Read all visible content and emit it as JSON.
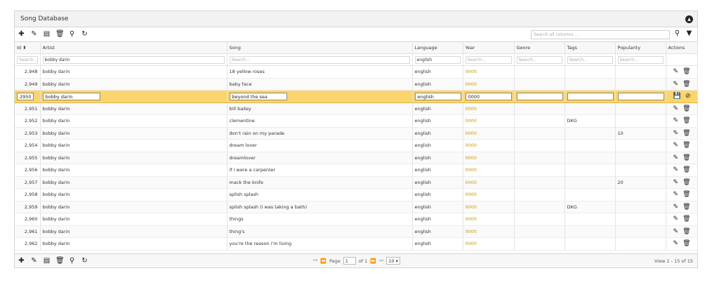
{
  "app": {
    "title": "Song Database"
  },
  "toolbar": {
    "search_placeholder": "Search all columns ..."
  },
  "columns": {
    "id": "Id",
    "artist": "Artist",
    "song": "Song",
    "language": "Language",
    "year": "Year",
    "genre": "Genre",
    "tags": "Tags",
    "popularity": "Popularity",
    "actions": "Actions"
  },
  "filters": {
    "id": "Search...",
    "artist": "bobby darin",
    "song": "Search...",
    "language": "english",
    "year": "Search...",
    "genre": "Search...",
    "tags": "Search...",
    "popularity": "Search..."
  },
  "rows": [
    {
      "id": "2,948",
      "artist": "bobby darin",
      "song": "18 yellow roses",
      "language": "english",
      "year": "0000",
      "genre": "",
      "tags": "",
      "popularity": ""
    },
    {
      "id": "2,949",
      "artist": "bobby darin",
      "song": "baby face",
      "language": "english",
      "year": "0000",
      "genre": "",
      "tags": "",
      "popularity": ""
    },
    {
      "id": "2950",
      "artist": "bobby darin",
      "song": "beyond the sea",
      "language": "english",
      "year": "0000",
      "genre": "",
      "tags": "",
      "popularity": "",
      "editing": true
    },
    {
      "id": "2,951",
      "artist": "bobby darin",
      "song": "bill bailey",
      "language": "english",
      "year": "0000",
      "genre": "",
      "tags": "",
      "popularity": ""
    },
    {
      "id": "2,952",
      "artist": "bobby darin",
      "song": "clementine",
      "language": "english",
      "year": "0000",
      "genre": "",
      "tags": "DKG",
      "popularity": ""
    },
    {
      "id": "2,953",
      "artist": "bobby darin",
      "song": "don't rain on my parade",
      "language": "english",
      "year": "0000",
      "genre": "",
      "tags": "",
      "popularity": "10"
    },
    {
      "id": "2,954",
      "artist": "bobby darin",
      "song": "dream lover",
      "language": "english",
      "year": "0000",
      "genre": "",
      "tags": "",
      "popularity": ""
    },
    {
      "id": "2,955",
      "artist": "bobby darin",
      "song": "dreamlover",
      "language": "english",
      "year": "0000",
      "genre": "",
      "tags": "",
      "popularity": ""
    },
    {
      "id": "2,956",
      "artist": "bobby darin",
      "song": "if i were a carpenter",
      "language": "english",
      "year": "0000",
      "genre": "",
      "tags": "",
      "popularity": ""
    },
    {
      "id": "2,957",
      "artist": "bobby darin",
      "song": "mack the knife",
      "language": "english",
      "year": "0000",
      "genre": "",
      "tags": "",
      "popularity": "20"
    },
    {
      "id": "2,958",
      "artist": "bobby darin",
      "song": "splish splash",
      "language": "english",
      "year": "0000",
      "genre": "",
      "tags": "",
      "popularity": ""
    },
    {
      "id": "2,959",
      "artist": "bobby darin",
      "song": "splish splash (i was taking a bath)",
      "language": "english",
      "year": "0000",
      "genre": "",
      "tags": "DKG",
      "popularity": ""
    },
    {
      "id": "2,960",
      "artist": "bobby darin",
      "song": "things",
      "language": "english",
      "year": "0000",
      "genre": "",
      "tags": "",
      "popularity": ""
    },
    {
      "id": "2,961",
      "artist": "bobby darin",
      "song": "thing's",
      "language": "english",
      "year": "0000",
      "genre": "",
      "tags": "",
      "popularity": ""
    },
    {
      "id": "2,962",
      "artist": "bobby darin",
      "song": "you're the reason i'm living",
      "language": "english",
      "year": "0000",
      "genre": "",
      "tags": "",
      "popularity": ""
    }
  ],
  "pager": {
    "page_label": "Page",
    "page_value": "1",
    "of_label": "of 1",
    "rows_per_page": "10",
    "view_info": "View 1 - 15 of 15"
  },
  "icons": [
    "plus-icon",
    "pencil-icon",
    "document-icon",
    "trash-icon",
    "search-icon",
    "refresh-icon",
    "filter-icon",
    "collapse-icon",
    "save-icon",
    "cancel-icon"
  ]
}
